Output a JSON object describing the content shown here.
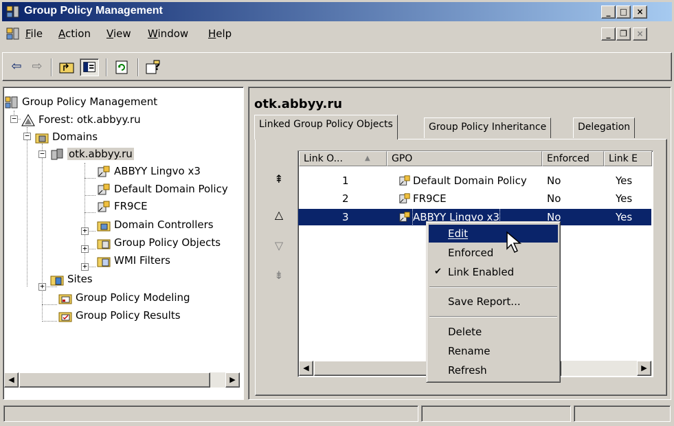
{
  "window": {
    "title": "Group Policy Management",
    "controls": {
      "minimize": "_",
      "maximize": "□",
      "close": "×"
    }
  },
  "menubar": {
    "items": [
      {
        "label": "File",
        "accel": "F",
        "rest": "ile"
      },
      {
        "label": "Action",
        "accel": "A",
        "rest": "ction"
      },
      {
        "label": "View",
        "accel": "V",
        "rest": "iew"
      },
      {
        "label": "Window",
        "accel": "W",
        "rest": "indow"
      },
      {
        "label": "Help",
        "accel": "H",
        "rest": "elp"
      }
    ],
    "mdi_controls": {
      "minimize": "_",
      "restore": "❐",
      "close": "×"
    }
  },
  "toolbar": {
    "back_icon": "back-arrow-icon",
    "forward_icon": "forward-arrow-icon",
    "up_icon": "up-folder-icon",
    "show_hide_tree_icon": "show-hide-tree-icon",
    "refresh_icon": "refresh-icon",
    "help_icon": "help-icon"
  },
  "tree": {
    "root": "Group Policy Management",
    "forest": "Forest: otk.abbyy.ru",
    "domains": "Domains",
    "domain": "otk.abbyy.ru",
    "gpo_links": [
      "ABBYY Lingvo x3",
      "Default Domain Policy",
      "FR9CE"
    ],
    "domain_controllers": "Domain Controllers",
    "group_policy_objects": "Group Policy Objects",
    "wmi_filters": "WMI Filters",
    "sites": "Sites",
    "modeling": "Group Policy Modeling",
    "results": "Group Policy Results"
  },
  "details": {
    "title": "otk.abbyy.ru",
    "tabs": [
      "Linked Group Policy Objects",
      "Group Policy Inheritance",
      "Delegation"
    ],
    "active_tab": 0,
    "columns": [
      "Link O...",
      "GPO",
      "Enforced",
      "Link E"
    ],
    "rows": [
      {
        "order": "1",
        "gpo": "Default Domain Policy",
        "enforced": "No",
        "link_enabled": "Yes",
        "selected": false
      },
      {
        "order": "2",
        "gpo": "FR9CE",
        "enforced": "No",
        "link_enabled": "Yes",
        "selected": false
      },
      {
        "order": "3",
        "gpo": "ABBYY Lingvo x3",
        "enforced": "No",
        "link_enabled": "Yes",
        "selected": true
      }
    ],
    "order_buttons": [
      "move-to-top-icon",
      "move-up-icon",
      "move-down-icon",
      "move-to-bottom-icon"
    ]
  },
  "context_menu": {
    "items": [
      {
        "label": "Edit",
        "highlighted": true
      },
      {
        "label": "Enforced"
      },
      {
        "label": "Link Enabled",
        "checked": true
      },
      {
        "label": "Save Report..."
      },
      {
        "label": "Delete"
      },
      {
        "label": "Rename"
      },
      {
        "label": "Refresh"
      }
    ]
  },
  "colors": {
    "title_gradient_start": "#0a246a",
    "title_gradient_end": "#a6caf0",
    "selection": "#0a246a",
    "face": "#d4d0c8"
  }
}
